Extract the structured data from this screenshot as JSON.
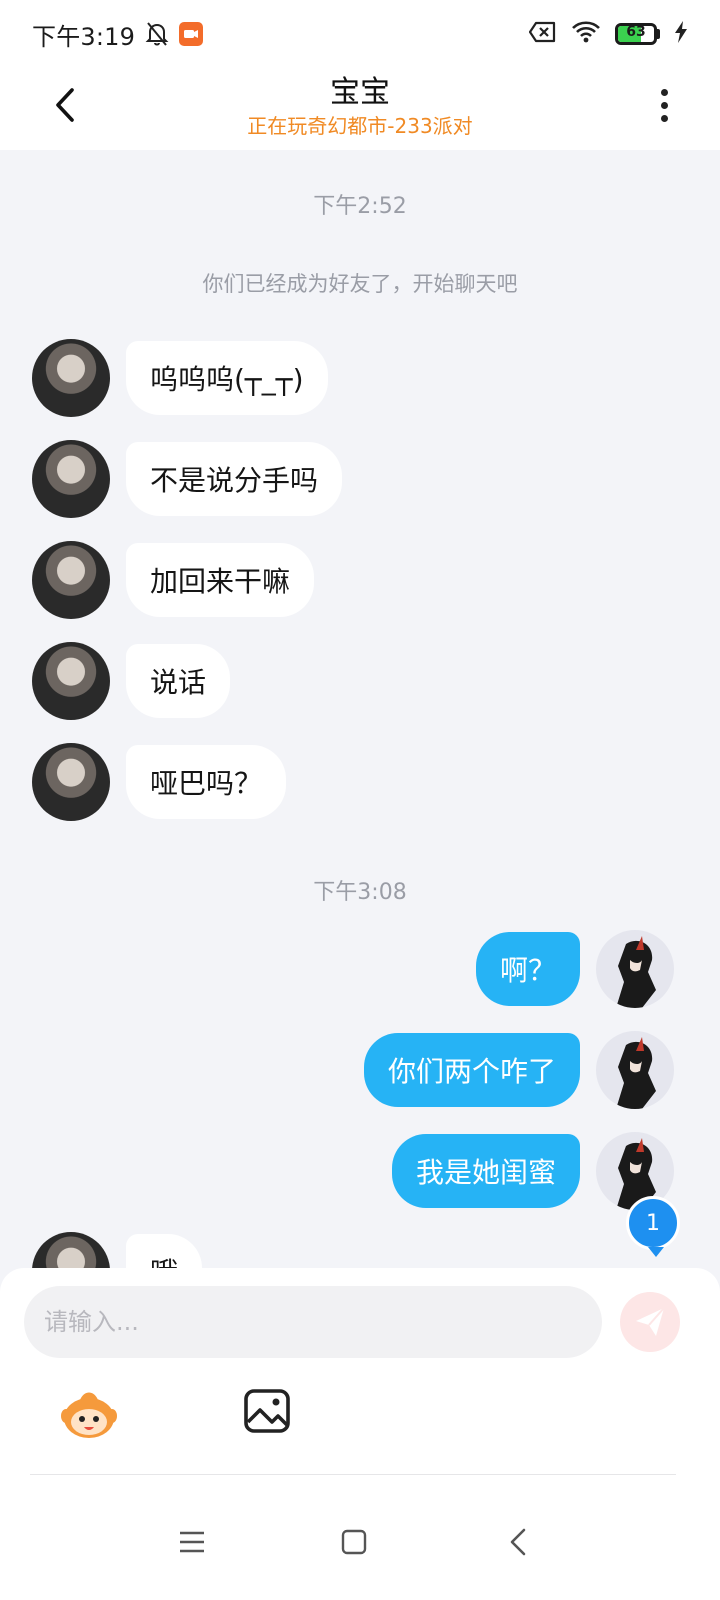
{
  "status_bar": {
    "time": "下午3:19",
    "battery_level": "63",
    "battery_fraction": 0.63
  },
  "header": {
    "title": "宝宝",
    "subtitle": "正在玩奇幻都市-233派对"
  },
  "chat": {
    "timestamp_1": "下午2:52",
    "system_notice": "你们已经成为好友了，开始聊天吧",
    "incoming": [
      {
        "text": "呜呜呜(┬_┬)"
      },
      {
        "text": "不是说分手吗"
      },
      {
        "text": "加回来干嘛"
      },
      {
        "text": "说话"
      },
      {
        "text": "哑巴吗？"
      }
    ],
    "timestamp_2": "下午3:08",
    "outgoing": [
      {
        "text": "啊？"
      },
      {
        "text": "你们两个咋了"
      },
      {
        "text": "我是她闺蜜"
      }
    ],
    "partial_incoming": {
      "text": "哦"
    },
    "unread_count": "1"
  },
  "input": {
    "placeholder": "请输入..."
  },
  "icons": {
    "back": "chevron-left-icon",
    "more": "more-vertical-icon",
    "send": "send-icon",
    "emoji": "emoji-mascot-icon",
    "image": "image-icon",
    "bell_muted": "bell-off-icon",
    "record": "screen-record-icon",
    "wifi": "wifi-icon",
    "no_sim": "no-sim-icon",
    "charging": "charging-bolt-icon",
    "nav_menu": "menu-icon",
    "nav_home": "home-square-icon",
    "nav_back": "nav-back-icon"
  },
  "colors": {
    "accent_out": "#26b3f5",
    "subtitle": "#f08a24",
    "badge": "#1e90f0",
    "send_bg": "#fde6e6"
  }
}
